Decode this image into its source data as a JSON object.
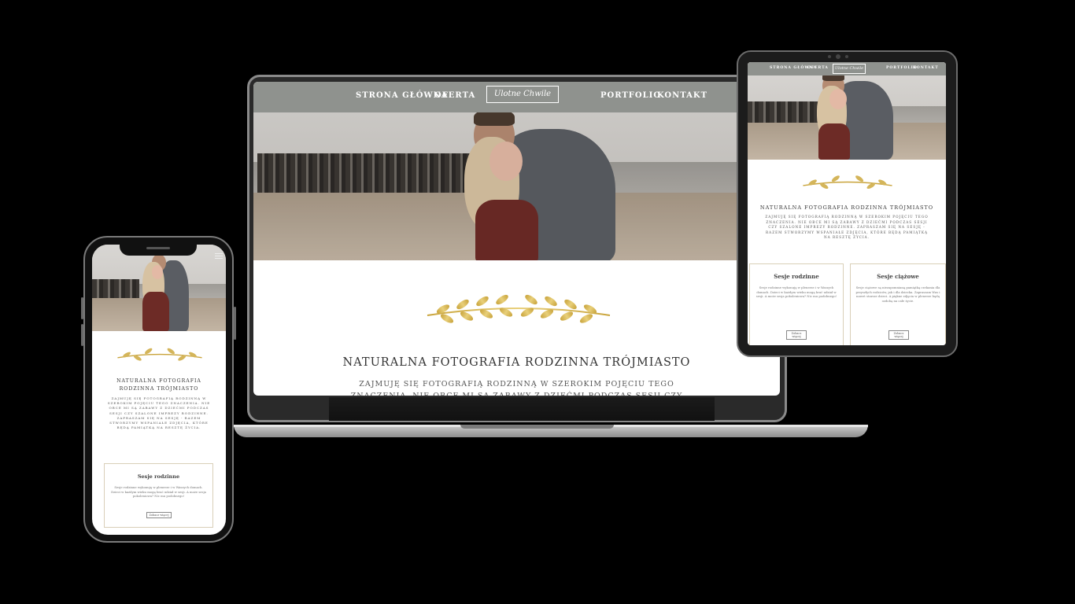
{
  "site": {
    "nav": {
      "home": "STRONA GŁÓWNA",
      "offer": "OFERTA",
      "portfolio": "PORTFOLIO",
      "contact": "KONTAKT"
    },
    "logo": "Ulotne Chwile",
    "heading": "NATURALNA FOTOGRAFIA RODZINNA TRÓJMIASTO",
    "intro": "ZAJMUJĘ SIĘ FOTOGRAFIĄ RODZINNĄ W SZEROKIM POJĘCIU TEGO ZNACZENIA. NIE OBCE MI SĄ ZABAWY Z DZIEĆMI PODCZAS SESJI CZY SZALONE IMPREZY RODZINNE. ZAPRASZAM SIĘ NA SESJĘ - RAZEM STWORZYMY WSPANIAŁE ZDJĘCIA, KTÓRE BĘDĄ PAMIĄTKĄ NA RESZTĘ ŻYCIA.",
    "cards": [
      {
        "title": "Sesje rodzinne",
        "text": "Sesje rodzinne wykonuję w plenerze i w Waszych domach. Dzieci w każdym wieku mogą brać udział w sesji. A może sesja pokoleniowa? Nic mu podobnego!",
        "button": "Zobacz więcej"
      },
      {
        "title": "Sesje ciążowe",
        "text": "Sesje ciążowe są niezapomnianą pamiątką czekania dla przyszłych rodziców, jak i dla dziecka. Zapraszam Was i nawet starsze dzieci. A piękne zdjęcia w plenerze będą ozdobą na całe życie.",
        "button": "Zobacz więcej"
      }
    ]
  },
  "colors": {
    "background": "#000000",
    "nav": "#8f928e",
    "gold": "#c9a43c",
    "text": "#333333"
  },
  "icons": [
    "gold-laurel-icon",
    "hamburger-menu-icon"
  ]
}
